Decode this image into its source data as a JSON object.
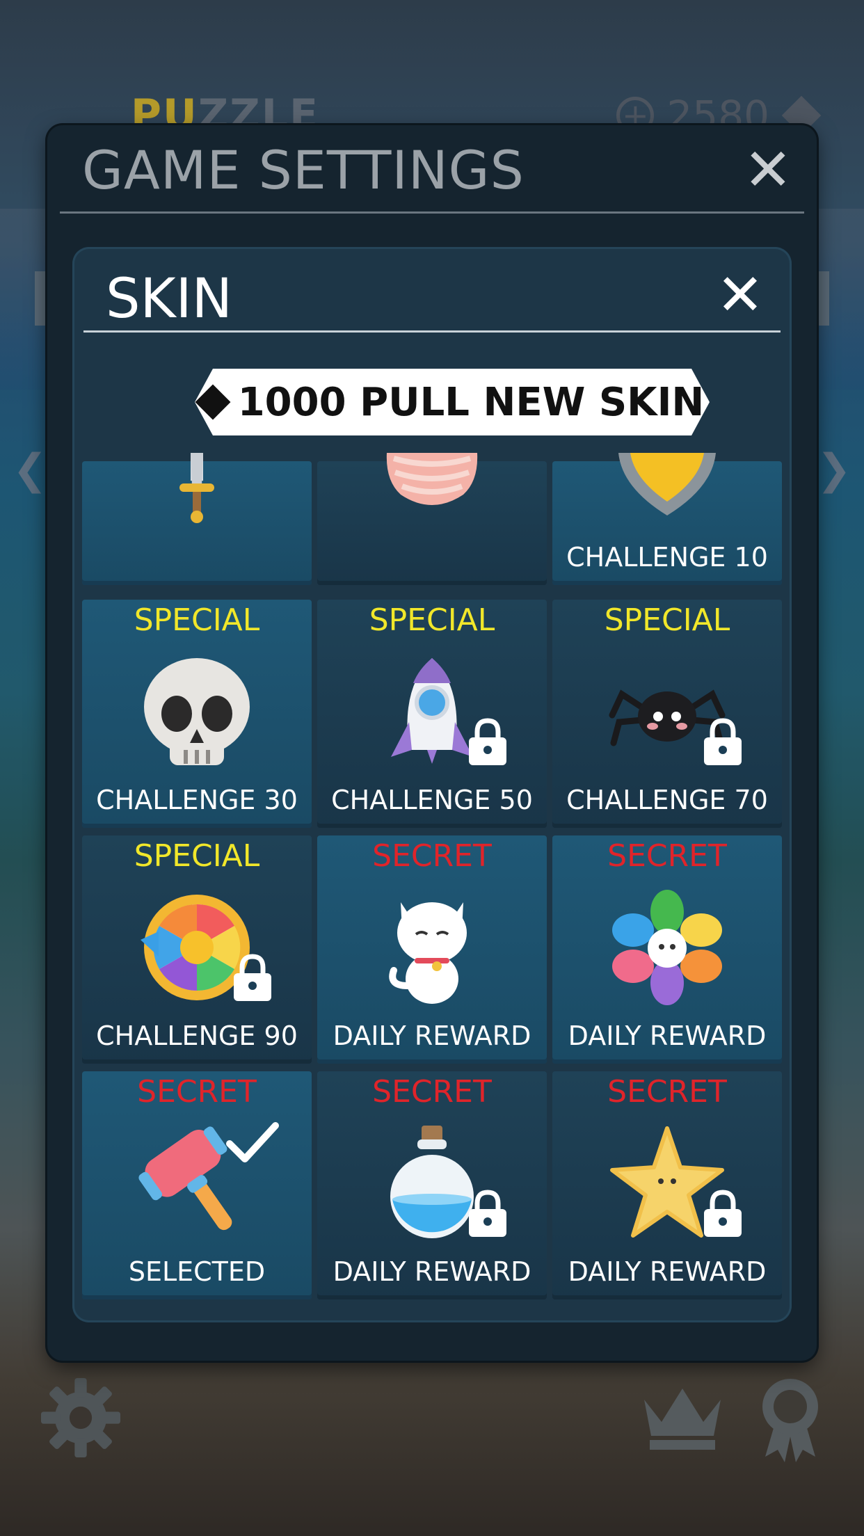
{
  "background": {
    "title_left_hl": "PU",
    "title_left_rest": "ZZLE",
    "coins": "2580"
  },
  "dialog": {
    "title": "GAME SETTINGS",
    "close_glyph": "✕"
  },
  "panel": {
    "title": "SKIN",
    "close_glyph": "✕",
    "pull_button": {
      "cost": "1000",
      "label": "1000 PULL NEW SKIN"
    }
  },
  "skins": [
    {
      "tag": "",
      "tag_type": "",
      "icon": "sword-icon",
      "label": "",
      "locked": false,
      "selected": false
    },
    {
      "tag": "",
      "tag_type": "",
      "icon": "shell-icon",
      "label": "",
      "locked": false,
      "selected": false
    },
    {
      "tag": "",
      "tag_type": "",
      "icon": "shield-icon",
      "label": "CHALLENGE 10",
      "locked": false,
      "selected": false
    },
    {
      "tag": "SPECIAL",
      "tag_type": "special",
      "icon": "skull-icon",
      "label": "CHALLENGE 30",
      "locked": false,
      "selected": false
    },
    {
      "tag": "SPECIAL",
      "tag_type": "special",
      "icon": "rocket-icon",
      "label": "CHALLENGE 50",
      "locked": true,
      "selected": false
    },
    {
      "tag": "SPECIAL",
      "tag_type": "special",
      "icon": "spider-icon",
      "label": "CHALLENGE 70",
      "locked": true,
      "selected": false
    },
    {
      "tag": "SPECIAL",
      "tag_type": "special",
      "icon": "wheel-icon",
      "label": "CHALLENGE 90",
      "locked": true,
      "selected": false
    },
    {
      "tag": "SECRET",
      "tag_type": "secret",
      "icon": "cat-icon",
      "label": "DAILY REWARD",
      "locked": false,
      "selected": false
    },
    {
      "tag": "SECRET",
      "tag_type": "secret",
      "icon": "flower-icon",
      "label": "DAILY REWARD",
      "locked": false,
      "selected": false
    },
    {
      "tag": "SECRET",
      "tag_type": "secret",
      "icon": "hammer-icon",
      "label": "SELECTED",
      "locked": false,
      "selected": true
    },
    {
      "tag": "SECRET",
      "tag_type": "secret",
      "icon": "potion-icon",
      "label": "DAILY REWARD",
      "locked": true,
      "selected": false
    },
    {
      "tag": "SECRET",
      "tag_type": "secret",
      "icon": "starfish-icon",
      "label": "DAILY REWARD",
      "locked": true,
      "selected": false
    }
  ],
  "bottom_bar": {
    "left_icon": "settings-gear-icon",
    "right_icons": [
      "crown-icon",
      "badge-icon"
    ]
  },
  "colors": {
    "special": "#f1e72a",
    "secret": "#e0242a",
    "dialog_bg": "#15242f",
    "panel_bg": "#1d3647",
    "cell_bg": "#1f5876"
  }
}
